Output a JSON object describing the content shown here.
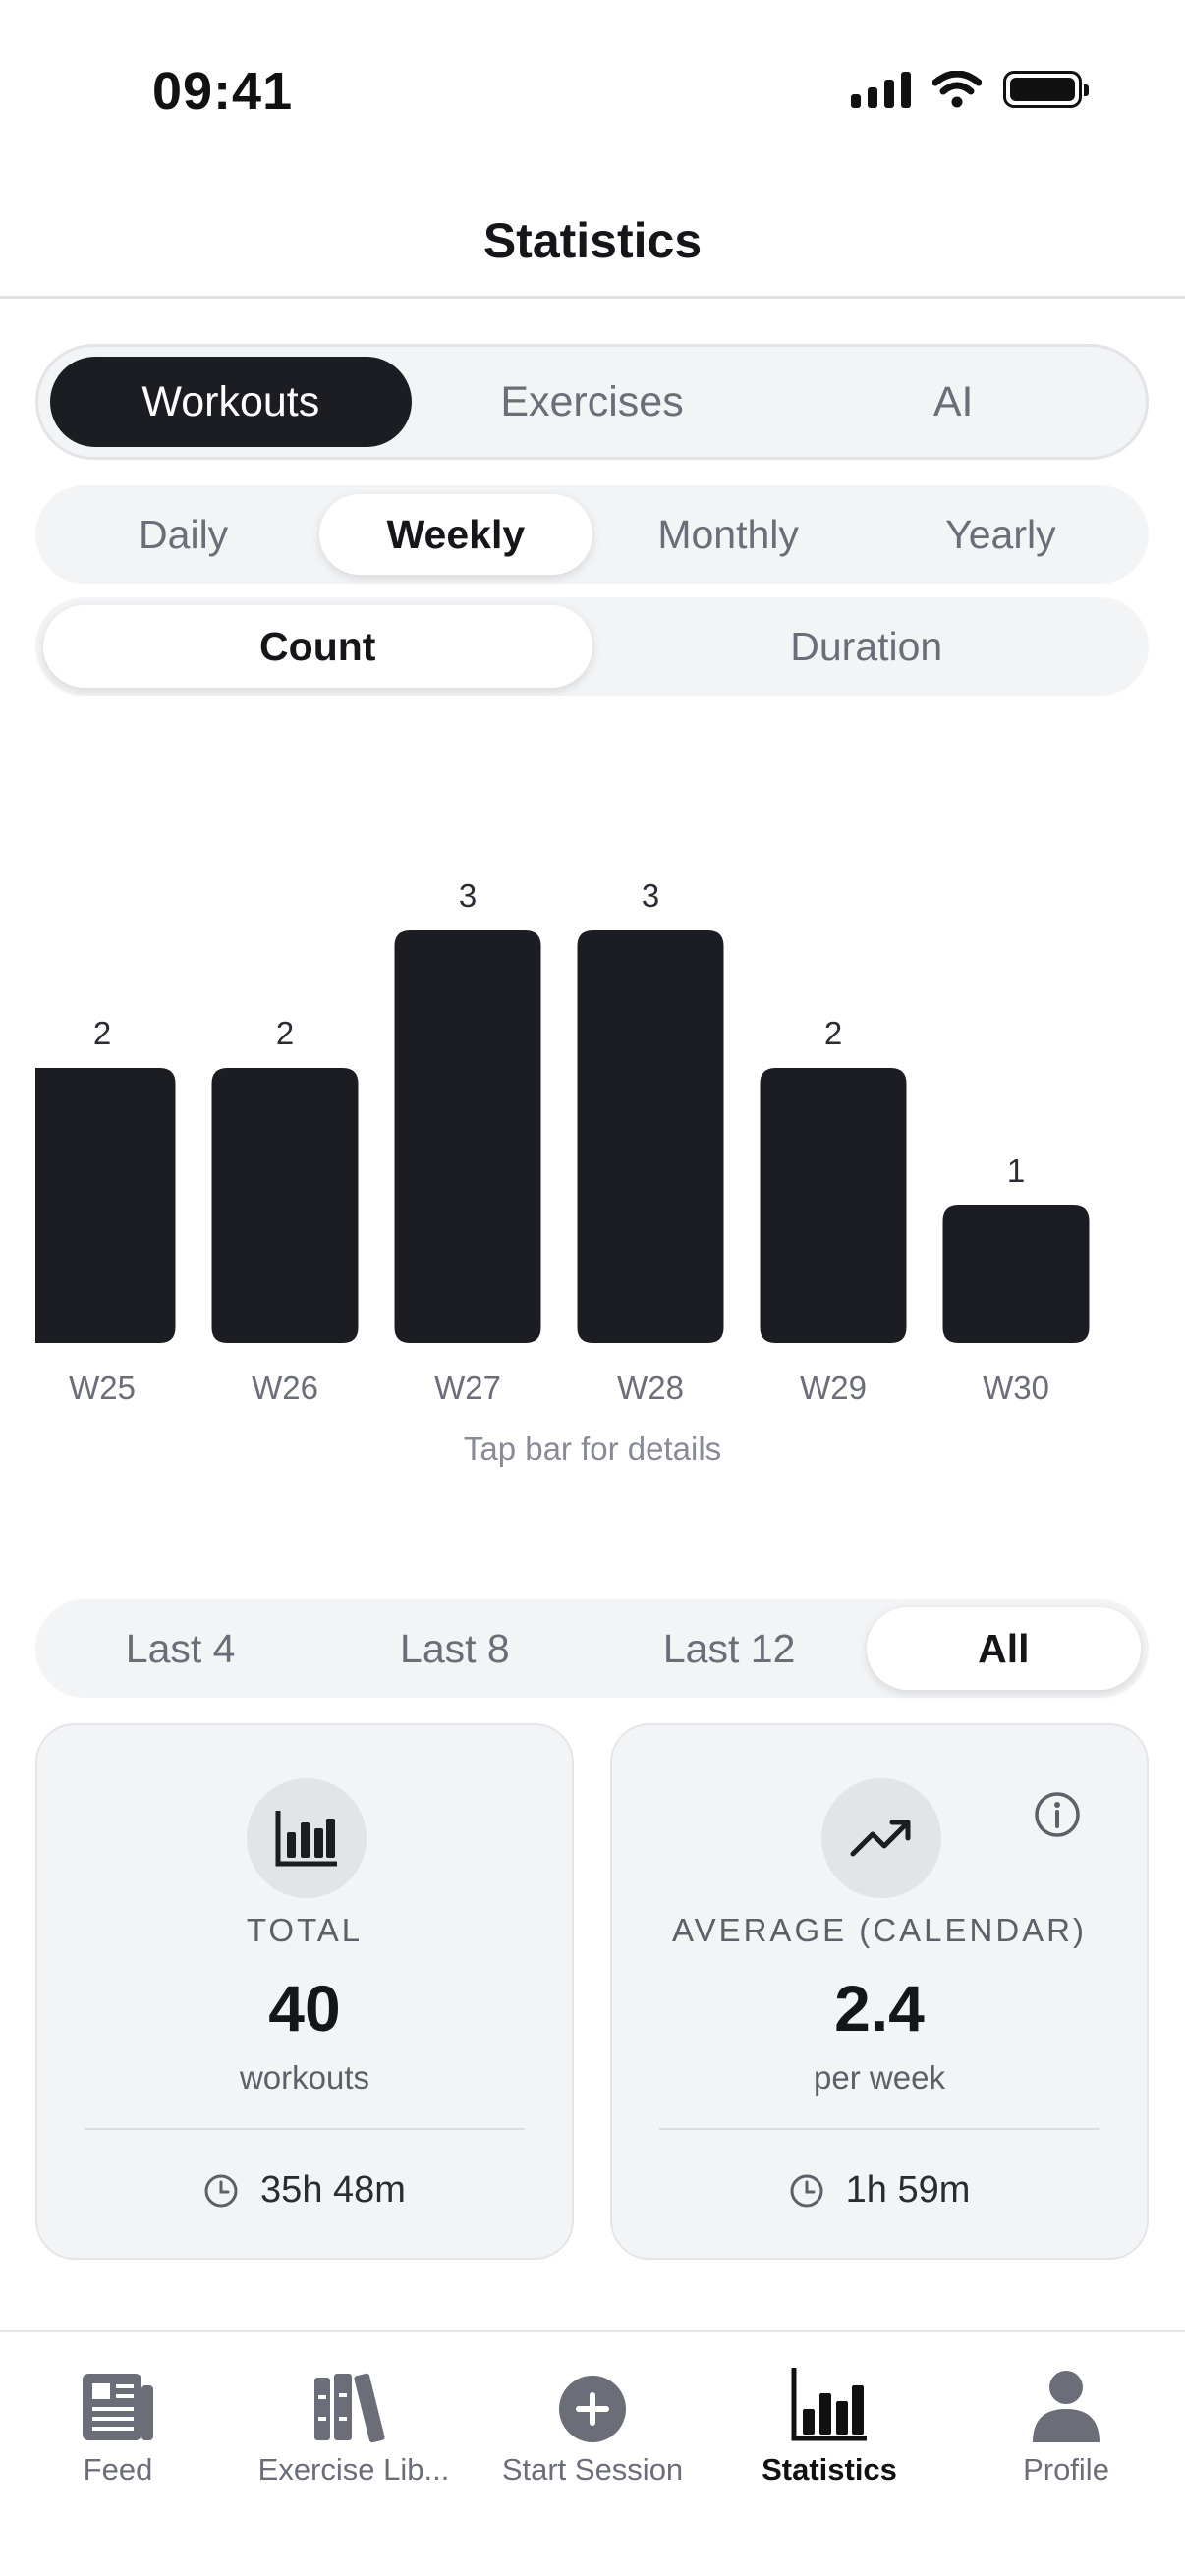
{
  "status_bar": {
    "time": "09:41"
  },
  "header": {
    "title": "Statistics"
  },
  "main_tabs": [
    {
      "label": "Workouts",
      "active": true
    },
    {
      "label": "Exercises",
      "active": false
    },
    {
      "label": "AI",
      "active": false
    }
  ],
  "period_tabs": [
    {
      "label": "Daily",
      "active": false
    },
    {
      "label": "Weekly",
      "active": true
    },
    {
      "label": "Monthly",
      "active": false
    },
    {
      "label": "Yearly",
      "active": false
    }
  ],
  "metric_tabs": [
    {
      "label": "Count",
      "active": true
    },
    {
      "label": "Duration",
      "active": false
    }
  ],
  "chart_data": {
    "type": "bar",
    "categories": [
      "W25",
      "W26",
      "W27",
      "W28",
      "W29",
      "W30"
    ],
    "values": [
      2,
      2,
      3,
      3,
      2,
      1
    ],
    "data_labels": [
      "2",
      "2",
      "3",
      "3",
      "2",
      "1"
    ],
    "ylim": [
      0,
      3
    ],
    "bar_color": "#1b1d22",
    "grid": false,
    "hint": "Tap bar for details"
  },
  "range_tabs": [
    {
      "label": "Last 4",
      "active": false
    },
    {
      "label": "Last 8",
      "active": false
    },
    {
      "label": "Last 12",
      "active": false
    },
    {
      "label": "All",
      "active": true
    }
  ],
  "cards": {
    "total": {
      "icon": "bar-chart-icon",
      "label": "TOTAL",
      "value": "40",
      "unit": "workouts",
      "duration": "35h 48m"
    },
    "average": {
      "icon": "trending-up-icon",
      "label": "AVERAGE (CALENDAR)",
      "value": "2.4",
      "unit": "per week",
      "duration": "1h 59m"
    }
  },
  "tab_bar": [
    {
      "label": "Feed",
      "icon": "feed-icon",
      "active": false
    },
    {
      "label": "Exercise Lib...",
      "icon": "library-icon",
      "active": false
    },
    {
      "label": "Start Session",
      "icon": "plus-circle-icon",
      "active": false
    },
    {
      "label": "Statistics",
      "icon": "statistics-icon",
      "active": true
    },
    {
      "label": "Profile",
      "icon": "profile-icon",
      "active": false
    }
  ],
  "colors": {
    "accent": "#1b1d22",
    "segment_bg": "#f3f4f6",
    "muted_text": "#6b6e78"
  }
}
